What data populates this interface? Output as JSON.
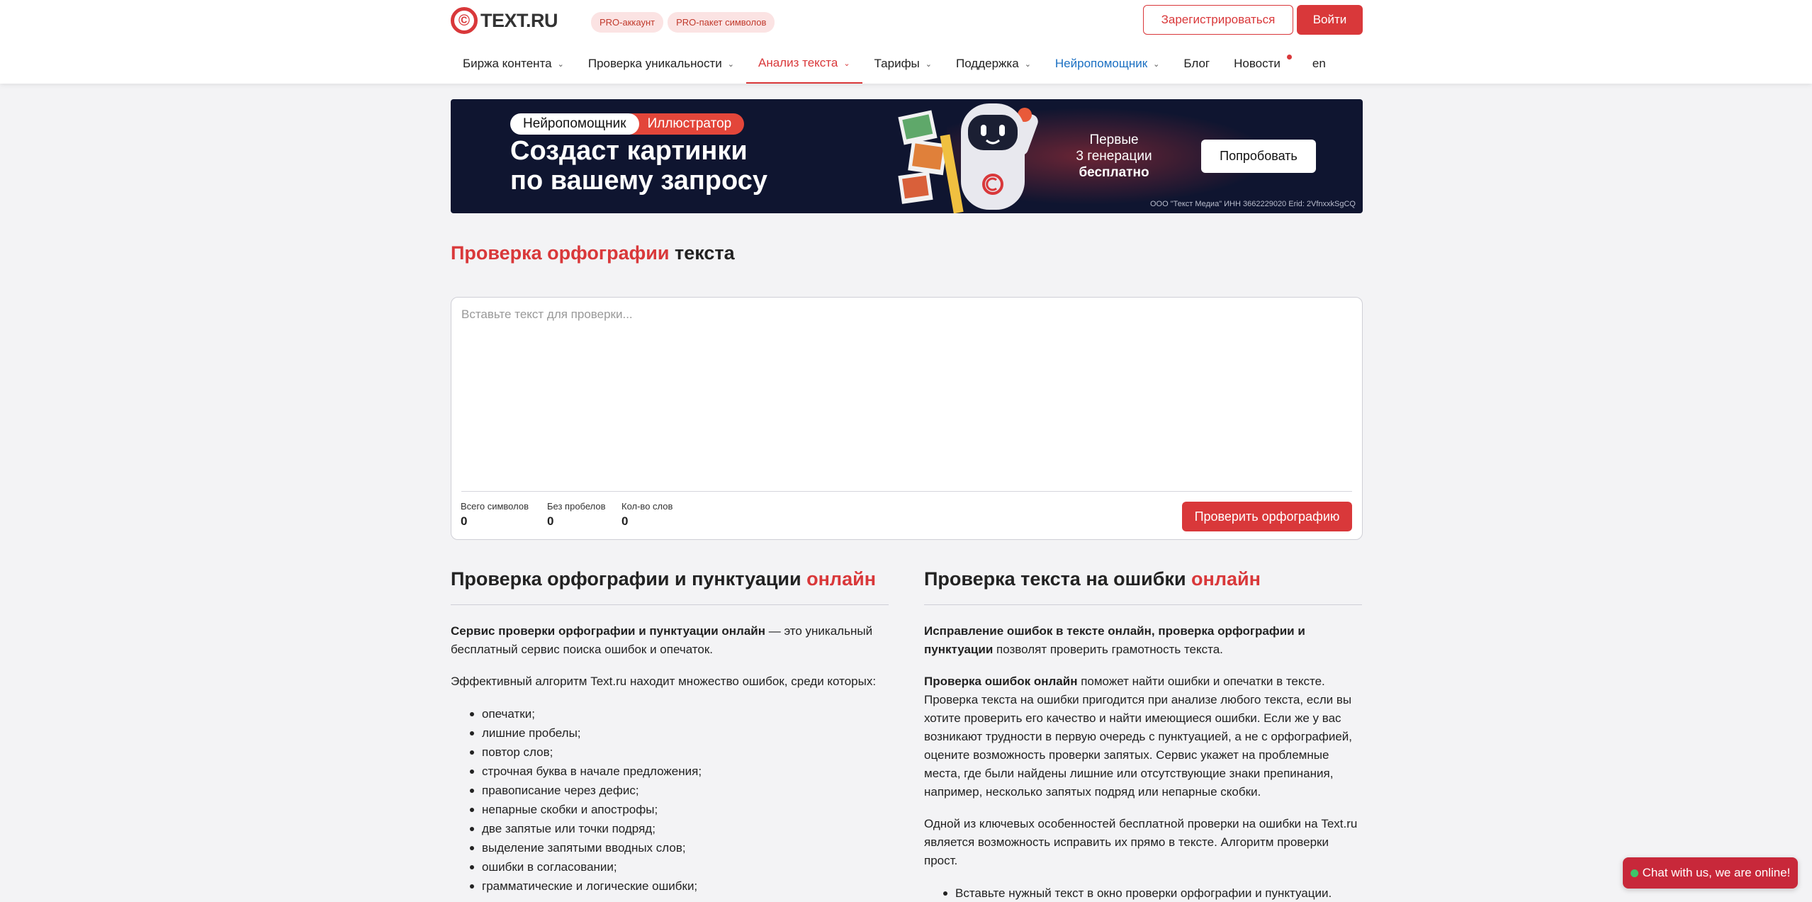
{
  "header": {
    "logo_text": "TEXT.RU",
    "logo_symbol": "©",
    "pro_badges": [
      "PRO-аккаунт",
      "PRO-пакет символов"
    ],
    "register_label": "Зарегистрироваться",
    "login_label": "Войти"
  },
  "nav": {
    "items": [
      {
        "label": "Биржа контента"
      },
      {
        "label": "Проверка уникальности"
      },
      {
        "label": "Анализ текста"
      },
      {
        "label": "Тарифы"
      },
      {
        "label": "Поддержка"
      },
      {
        "label": "Нейропомощник"
      },
      {
        "label": "Блог"
      },
      {
        "label": "Новости"
      },
      {
        "label": "en"
      }
    ]
  },
  "banner": {
    "tag_primary": "Нейропомощник",
    "tag_secondary": "Иллюстратор",
    "title_line1": "Создаст картинки",
    "title_line2": "по вашему запросу",
    "side_line1": "Первые",
    "side_line2": "3 генерации",
    "side_line3": "бесплатно",
    "button_label": "Попробовать",
    "legal": "ООО \"Текст Медиа\" ИНН 3662229020 Erid: 2VfnxxkSgCQ"
  },
  "page_title": {
    "highlight": "Проверка орфографии",
    "rest": " текста"
  },
  "checker": {
    "placeholder": "Вставьте текст для проверки...",
    "stats": [
      {
        "label": "Всего символов",
        "value": "0"
      },
      {
        "label": "Без пробелов",
        "value": "0"
      },
      {
        "label": "Кол-во слов",
        "value": "0"
      }
    ],
    "check_button": "Проверить орфографию"
  },
  "left_column": {
    "heading": "Проверка орфографии и пунктуации ",
    "heading_highlight": "онлайн",
    "p1_bold": "Сервис проверки орфографии и пунктуации онлайн",
    "p1_rest": " — это уникальный бесплатный сервис поиска ошибок и опечаток.",
    "p2": "Эффективный алгоритм Text.ru находит множество ошибок, среди которых:",
    "list": [
      "опечатки;",
      "лишние пробелы;",
      "повтор слов;",
      "строчная буква в начале предложения;",
      "правописание через дефис;",
      "непарные скобки и апострофы;",
      "две запятые или точки подряд;",
      "выделение запятыми вводных слов;",
      "ошибки в согласовании;",
      "грамматические и логические ошибки;"
    ]
  },
  "right_column": {
    "heading": "Проверка текста на ошибки ",
    "heading_highlight": "онлайн",
    "p1_bold": "Исправление ошибок в тексте онлайн, проверка орфографии и пунктуации",
    "p1_rest": " позволят проверить грамотность текста.",
    "p2_bold": "Проверка ошибок онлайн",
    "p2_rest": " поможет найти ошибки и опечатки в тексте. Проверка текста на ошибки пригодится при анализе любого текста, если вы хотите проверить его качество и найти имеющиеся ошибки. Если же у вас возникают трудности в первую очередь с пунктуацией, а не с орфографией, оцените возможность проверки запятых. Сервис укажет на проблемные места, где были найдены лишние или отсутствующие знаки препинания, например, несколько запятых подряд или непарные скобки.",
    "p3": "Одной из ключевых особенностей бесплатной проверки на ошибки на Text.ru является возможность исправить их прямо в тексте. Алгоритм проверки прост.",
    "list": [
      "Вставьте нужный текст в окно проверки орфографии и пунктуации."
    ]
  },
  "chat": {
    "label": "Chat with us, we are online!"
  },
  "colors": {
    "accent": "#d9383a",
    "neuro_link": "#1a6fc2",
    "banner_bg": "#0f1530",
    "online_dot": "#3fc56a"
  }
}
